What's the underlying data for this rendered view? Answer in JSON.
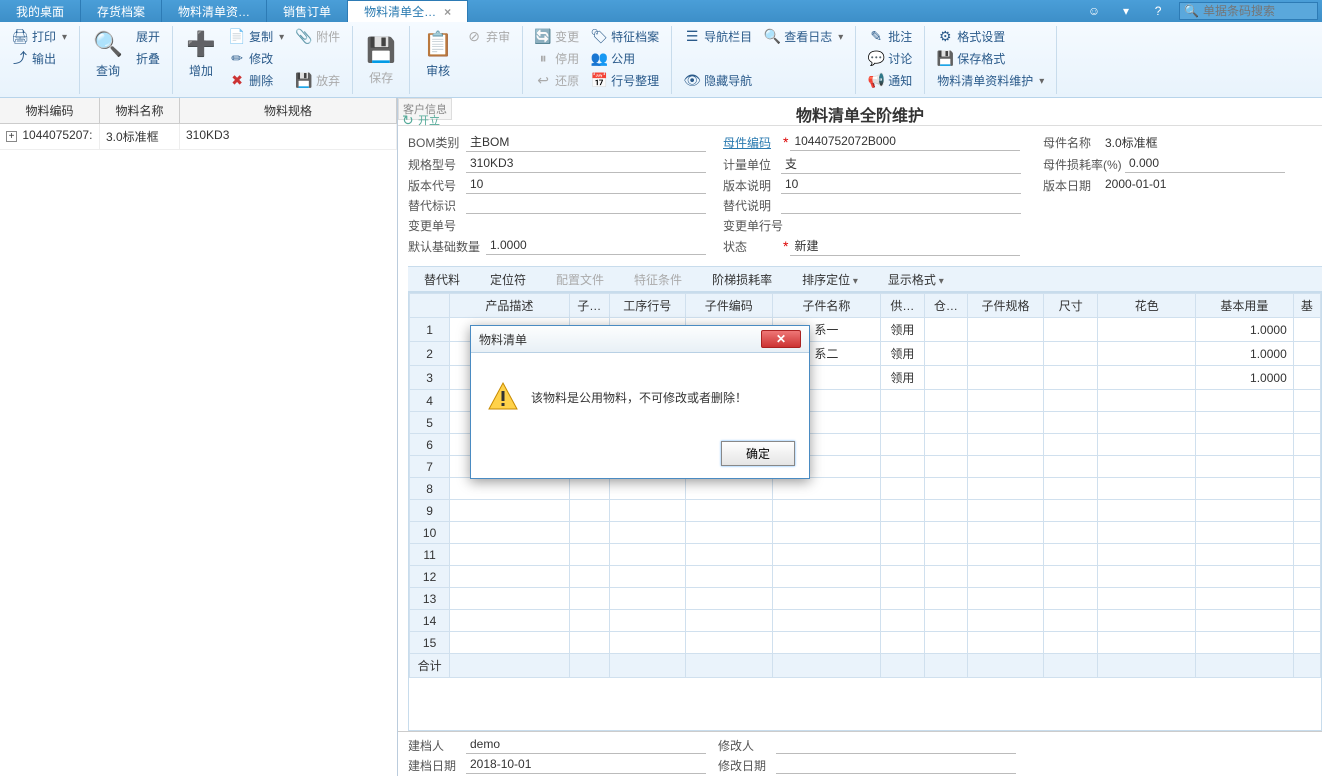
{
  "tabs": {
    "items": [
      "我的桌面",
      "存货档案",
      "物料清单资…",
      "销售订单",
      "物料清单全…"
    ],
    "active_index": 4,
    "close_x": "×"
  },
  "search": {
    "placeholder": "单据条码搜索"
  },
  "ribbon": {
    "print": "打印",
    "export": "输出",
    "expand": "展开",
    "collapse": "折叠",
    "query": "查询",
    "add": "增加",
    "copy": "复制",
    "modify": "修改",
    "delete": "删除",
    "attach": "附件",
    "release": "放弃",
    "save": "保存",
    "audit": "审核",
    "abandon": "弃审",
    "change": "变更",
    "stop": "停用",
    "restore": "还原",
    "feature": "特征档案",
    "common": "公用",
    "linenum": "行号整理",
    "navbar": "导航栏目",
    "hidenav": "隐藏导航",
    "viewlog": "查看日志",
    "annotate": "批注",
    "discuss": "讨论",
    "notify": "通知",
    "format": "格式设置",
    "saveformat": "保存格式",
    "material_maint": "物料清单资料维护"
  },
  "sidetab": "客户信息",
  "refresh_label": "开立",
  "page_title": "物料清单全阶维护",
  "left": {
    "headers": {
      "code": "物料编码",
      "name": "物料名称",
      "spec": "物料规格"
    },
    "row": {
      "toggle": "+",
      "code": "1044075207:",
      "name": "3.0标准框",
      "spec": "310KD3"
    }
  },
  "form": {
    "bom_type_label": "BOM类别",
    "bom_type": "主BOM",
    "parent_code_label": "母件编码",
    "parent_code": "10440752072B000",
    "parent_name_label": "母件名称",
    "parent_name": "3.0标准框",
    "spec_label": "规格型号",
    "spec": "310KD3",
    "unit_label": "计量单位",
    "unit": "支",
    "loss_label": "母件损耗率(%)",
    "loss": "0.000",
    "ver_code_label": "版本代号",
    "ver_code": "10",
    "ver_desc_label": "版本说明",
    "ver_desc": "10",
    "ver_date_label": "版本日期",
    "ver_date": "2000-01-01",
    "sub_mark_label": "替代标识",
    "sub_desc_label": "替代说明",
    "change_no_label": "变更单号",
    "change_line_label": "变更单行号",
    "base_qty_label": "默认基础数量",
    "base_qty": "1.0000",
    "status_label": "状态",
    "status": "新建"
  },
  "grid_toolbar": {
    "sub": "替代料",
    "loc": "定位符",
    "config": "配置文件",
    "feature": "特征条件",
    "tier_loss": "阶梯损耗率",
    "sort": "排序定位",
    "display": "显示格式"
  },
  "grid": {
    "headers": [
      "",
      "产品描述",
      "子…",
      "工序行号",
      "子件编码",
      "子件名称",
      "供…",
      "仓…",
      "子件规格",
      "尺寸",
      "花色",
      "基本用量",
      "基"
    ],
    "rows": [
      {
        "n": "1",
        "name": "系一",
        "supply": "领用",
        "qty": "1.0000"
      },
      {
        "n": "2",
        "name": "系二",
        "supply": "领用",
        "qty": "1.0000"
      },
      {
        "n": "3",
        "name": "",
        "supply": "领用",
        "qty": "1.0000"
      },
      {
        "n": "4"
      },
      {
        "n": "5"
      },
      {
        "n": "6"
      },
      {
        "n": "7"
      },
      {
        "n": "8"
      },
      {
        "n": "9"
      },
      {
        "n": "10"
      },
      {
        "n": "11"
      },
      {
        "n": "12"
      },
      {
        "n": "13"
      },
      {
        "n": "14"
      },
      {
        "n": "15"
      }
    ],
    "totals_label": "合计"
  },
  "footer": {
    "creator_label": "建档人",
    "creator": "demo",
    "modifier_label": "修改人",
    "modifier": "",
    "create_date_label": "建档日期",
    "create_date": "2018-10-01",
    "modify_date_label": "修改日期",
    "modify_date": ""
  },
  "modal": {
    "title": "物料清单",
    "message": "该物料是公用物料，不可修改或者删除！",
    "ok": "确定"
  }
}
